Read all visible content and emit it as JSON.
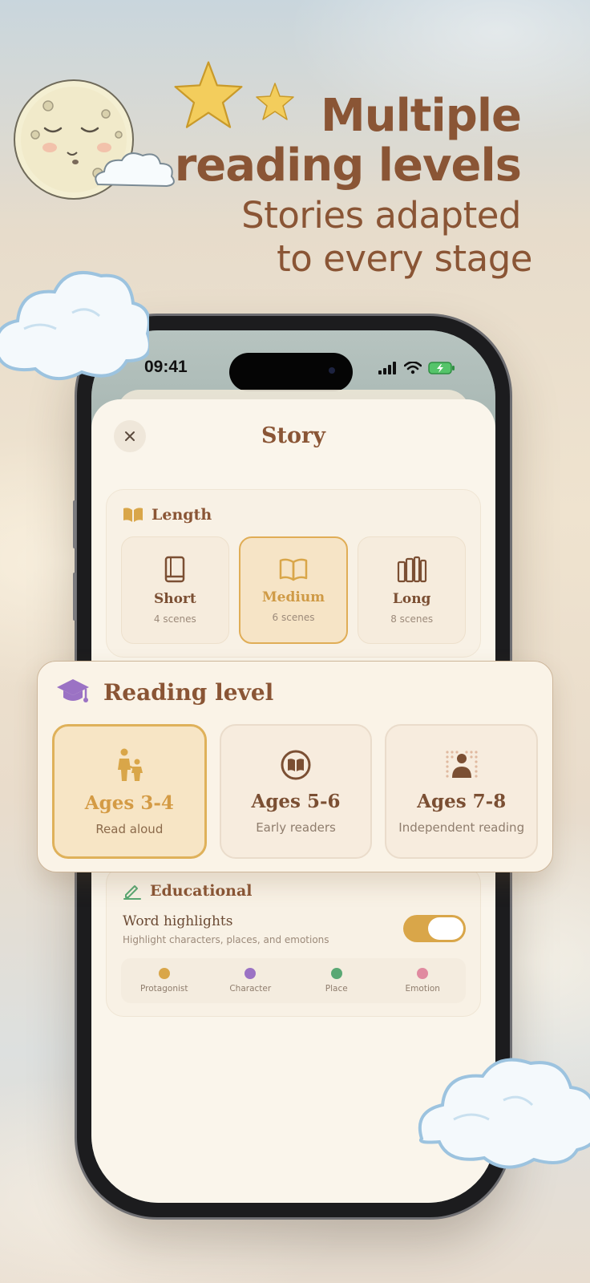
{
  "headline": {
    "title_line1": "Multiple",
    "title_line2": "reading levels",
    "subtitle_line1": "Stories adapted",
    "subtitle_line2": "to every stage"
  },
  "status_bar": {
    "time": "09:41"
  },
  "sheet": {
    "title": "Story",
    "close_icon": "close-icon"
  },
  "length": {
    "title": "Length",
    "options": [
      {
        "label": "Short",
        "sub": "4 scenes",
        "icon": "book-closed-icon",
        "selected": false
      },
      {
        "label": "Medium",
        "sub": "6 scenes",
        "icon": "book-open-icon",
        "selected": true
      },
      {
        "label": "Long",
        "sub": "8 scenes",
        "icon": "books-icon",
        "selected": false
      }
    ]
  },
  "reading_level": {
    "title": "Reading level",
    "options": [
      {
        "label": "Ages 3-4",
        "sub": "Read aloud",
        "icon": "parent-child-icon",
        "selected": true
      },
      {
        "label": "Ages 5-6",
        "sub": "Early readers",
        "icon": "book-circle-icon",
        "selected": false
      },
      {
        "label": "Ages 7-8",
        "sub": "Independent reading",
        "icon": "reader-person-icon",
        "selected": false
      }
    ]
  },
  "educational": {
    "title": "Educational",
    "row_title": "Word highlights",
    "row_sub": "Highlight characters, places, and emotions",
    "toggle_on": true,
    "legend": [
      {
        "label": "Protagonist",
        "color": "#d9a649"
      },
      {
        "label": "Character",
        "color": "#9b72c4"
      },
      {
        "label": "Place",
        "color": "#5aa874"
      },
      {
        "label": "Emotion",
        "color": "#e08aa0"
      }
    ]
  },
  "colors": {
    "accent": "#d9a649",
    "brown": "#8a5535",
    "cream": "#faf5eb"
  }
}
